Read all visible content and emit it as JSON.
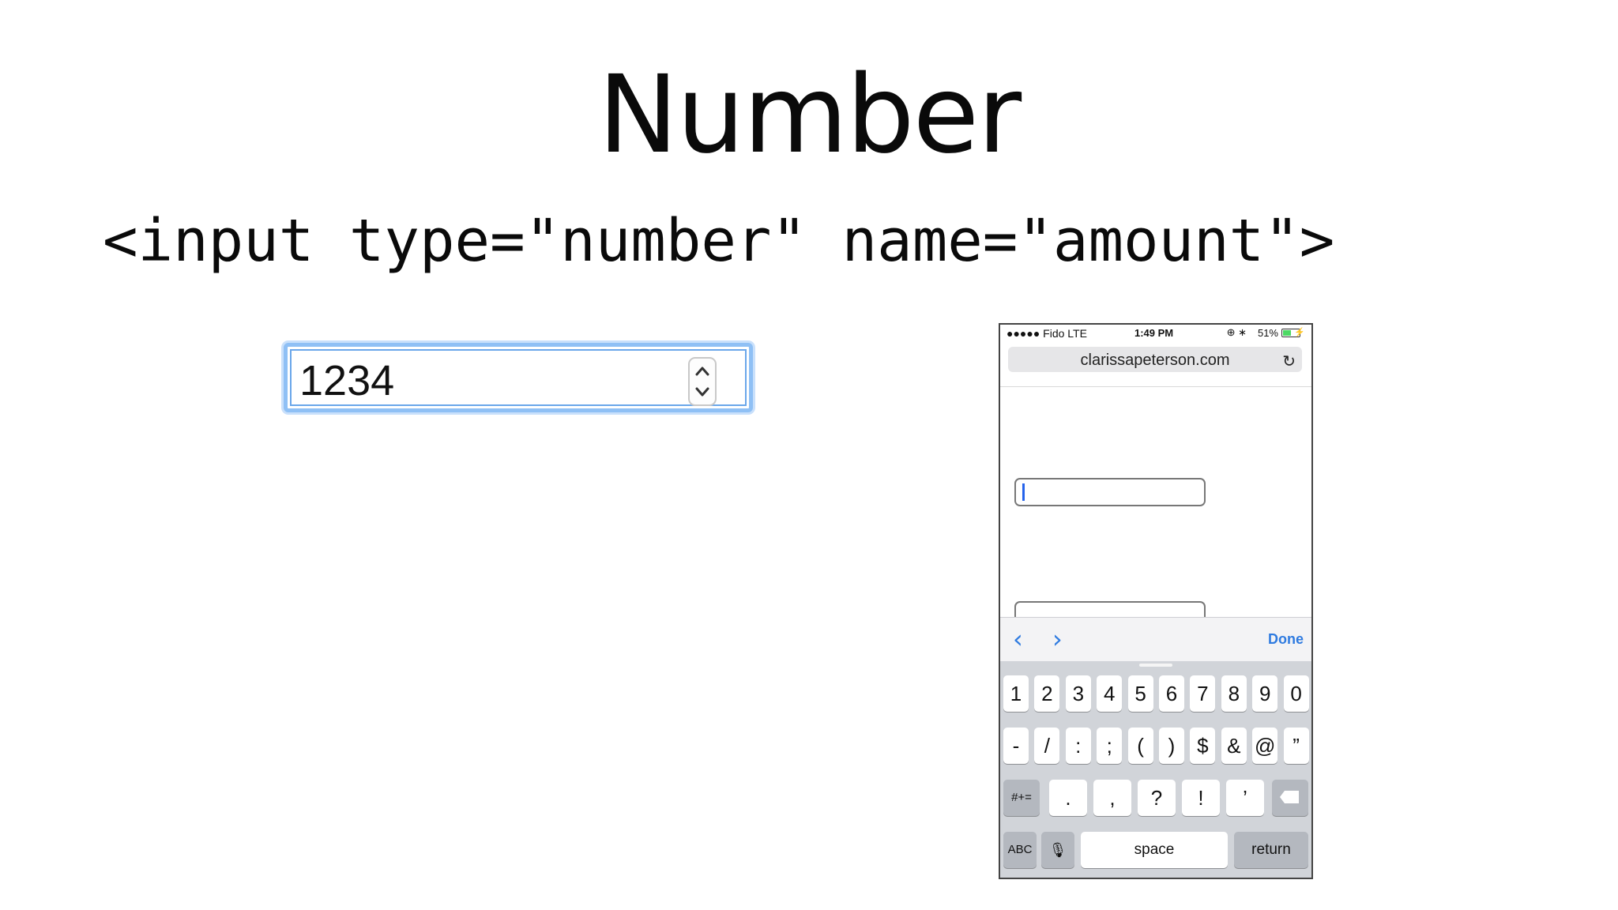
{
  "slide": {
    "title": "Number",
    "code": "<input type=\"number\" name=\"amount\">"
  },
  "desktop_input": {
    "value": "1234"
  },
  "phone": {
    "status": {
      "carrier": "●●●●● Fido  LTE",
      "time": "1:49 PM",
      "battery_percent": "51%",
      "battery_level": 0.51
    },
    "url": "clarissapeterson.com",
    "accessory": {
      "prev": "‹",
      "next": "›",
      "done": "Done"
    },
    "keyboard": {
      "row1": [
        "1",
        "2",
        "3",
        "4",
        "5",
        "6",
        "7",
        "8",
        "9",
        "0"
      ],
      "row2": [
        "-",
        "/",
        ":",
        ";",
        "(",
        ")",
        "$",
        "&",
        "@",
        "”"
      ],
      "row3": {
        "symbols_toggle": "#+=",
        "keys": [
          ".",
          ",",
          "?",
          "!",
          "’"
        ]
      },
      "row4": {
        "abc": "ABC",
        "space": "space",
        "return": "return"
      }
    }
  }
}
